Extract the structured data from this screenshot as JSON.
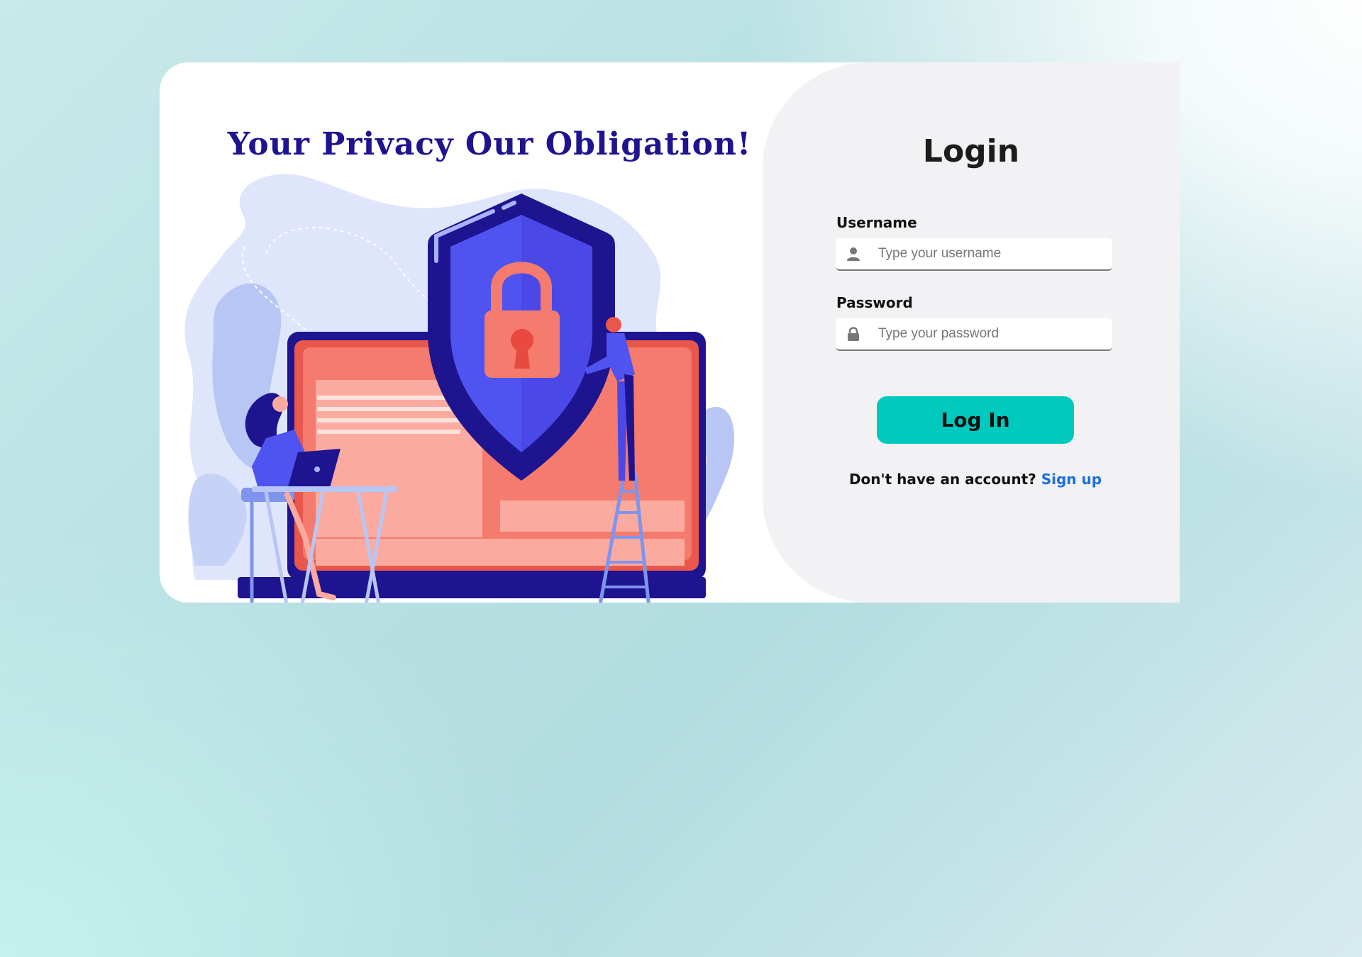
{
  "hero": {
    "headline": "Your Privacy Our Obligation!"
  },
  "login_form": {
    "title": "Login",
    "username": {
      "label": "Username",
      "placeholder": "Type your username",
      "icon": "user-icon"
    },
    "password": {
      "label": "Password",
      "placeholder": "Type your password",
      "icon": "lock-icon"
    },
    "submit_label": "Log In",
    "signup_prompt": "Don't have an account?",
    "signup_link": "Sign up"
  },
  "colors": {
    "headline": "#1e1490",
    "button": "#00c9bd",
    "link": "#1a6fe0",
    "form_panel": "#f2f2f4"
  }
}
